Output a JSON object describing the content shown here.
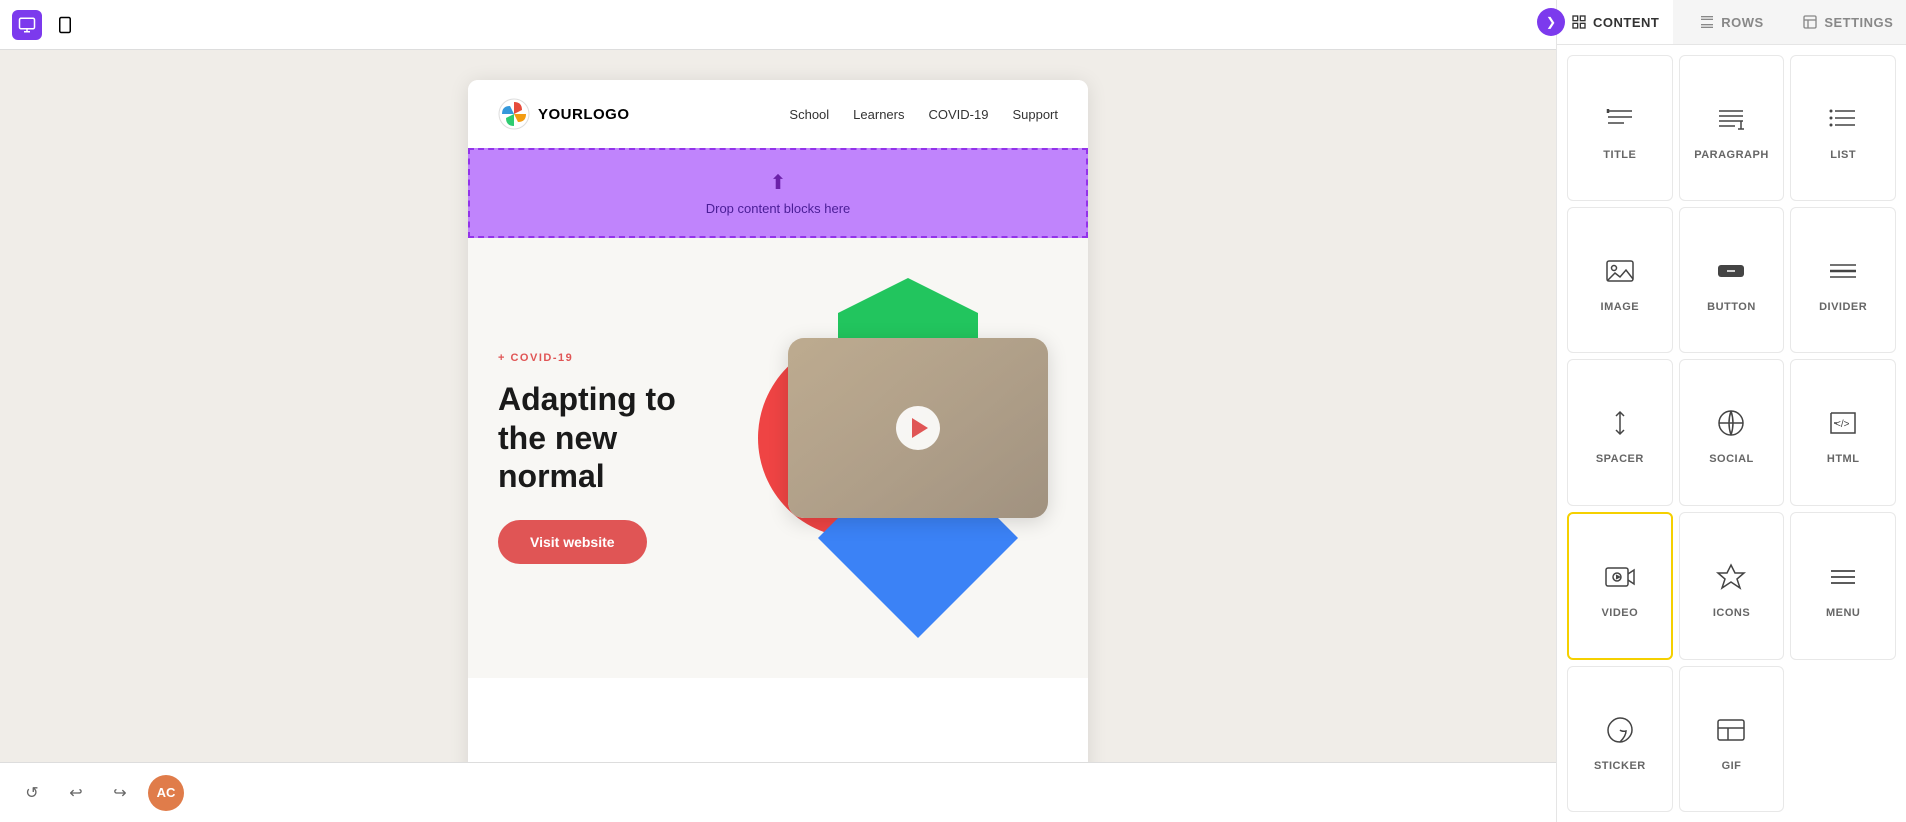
{
  "toolbar": {
    "desktop_label": "Desktop",
    "mobile_label": "Mobile",
    "undo_label": "Undo",
    "redo_label": "Redo",
    "history_label": "History",
    "user_initials": "AC"
  },
  "email": {
    "logo_text": "YOURLOGO",
    "nav": {
      "items": [
        "School",
        "Learners",
        "COVID-19",
        "Support"
      ]
    },
    "dropzone": {
      "text": "Drop content blocks here"
    },
    "hero": {
      "tag": "+ COVID-19",
      "title": "Adapting to the new normal",
      "button_label": "Visit website"
    }
  },
  "panel": {
    "tabs": [
      {
        "label": "CONTENT",
        "active": true
      },
      {
        "label": "ROWS",
        "active": false
      },
      {
        "label": "SETTINGS",
        "active": false
      }
    ],
    "content_items": [
      {
        "id": "title",
        "label": "TITLE"
      },
      {
        "id": "paragraph",
        "label": "PARAGRAPH"
      },
      {
        "id": "list",
        "label": "LIST"
      },
      {
        "id": "image",
        "label": "IMAGE"
      },
      {
        "id": "button",
        "label": "BUTTON"
      },
      {
        "id": "divider",
        "label": "DIVIDER"
      },
      {
        "id": "spacer",
        "label": "SPACER"
      },
      {
        "id": "social",
        "label": "SOCIAL"
      },
      {
        "id": "html",
        "label": "HTML"
      },
      {
        "id": "video",
        "label": "VIDEO",
        "highlighted": true
      },
      {
        "id": "icons",
        "label": "ICONS"
      },
      {
        "id": "menu",
        "label": "MENU"
      },
      {
        "id": "sticker",
        "label": "STICKER"
      },
      {
        "id": "gif",
        "label": "GIF"
      }
    ]
  }
}
